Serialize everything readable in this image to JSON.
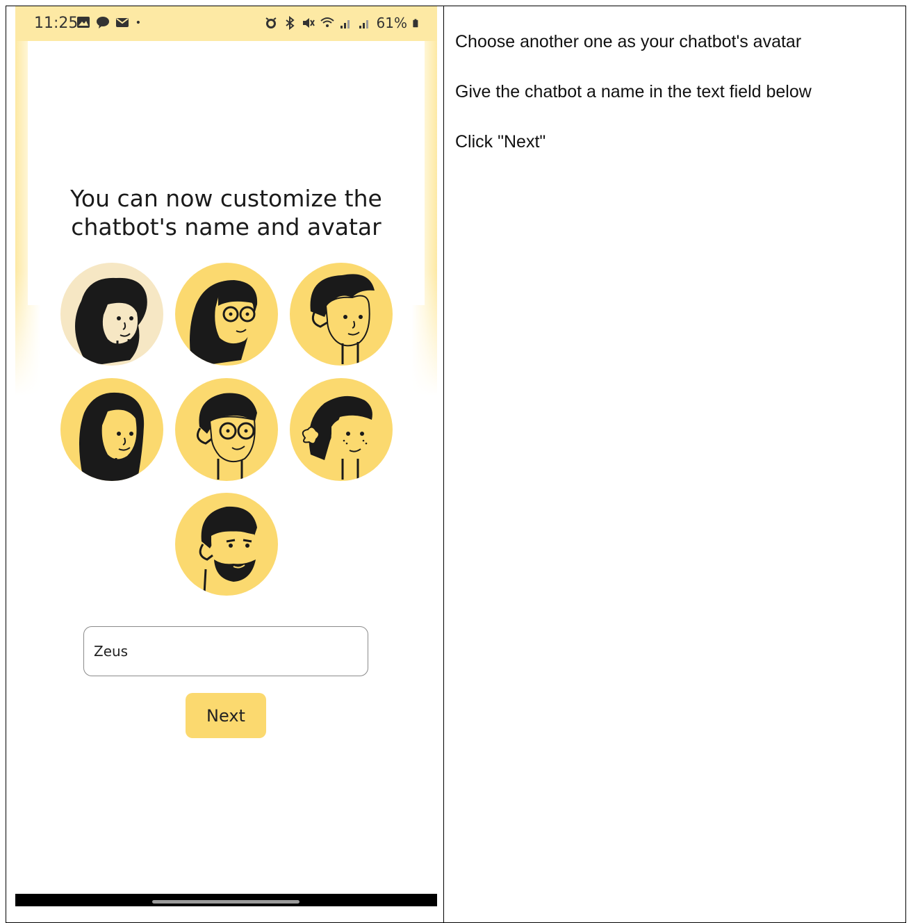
{
  "status_bar": {
    "time": "11:25",
    "battery": "61%",
    "icons_left": [
      "gallery-icon",
      "chat-icon",
      "mail-icon",
      "dot-icon"
    ],
    "icons_right": [
      "alarm-icon",
      "bluetooth-icon",
      "mute-icon",
      "wifi-icon",
      "signal-icon",
      "signal-icon",
      "battery-icon"
    ]
  },
  "screen": {
    "headline": "You can now customize the chatbot's name and avatar",
    "avatars": [
      {
        "name": "avatar-1",
        "selected": true
      },
      {
        "name": "avatar-2",
        "selected": false
      },
      {
        "name": "avatar-3",
        "selected": false
      },
      {
        "name": "avatar-4",
        "selected": false
      },
      {
        "name": "avatar-5",
        "selected": false
      },
      {
        "name": "avatar-6",
        "selected": false
      },
      {
        "name": "avatar-7",
        "selected": false
      }
    ],
    "name_input_value": "Zeus",
    "next_label": "Next"
  },
  "instructions": [
    "Choose another one as your chatbot's avatar",
    "Give the chatbot a name in the text field below",
    "Click \"Next\""
  ],
  "colors": {
    "accent": "#fbd96f",
    "selected_avatar_bg": "#f6e7c4",
    "statusbar_bg": "#fde9a4"
  }
}
